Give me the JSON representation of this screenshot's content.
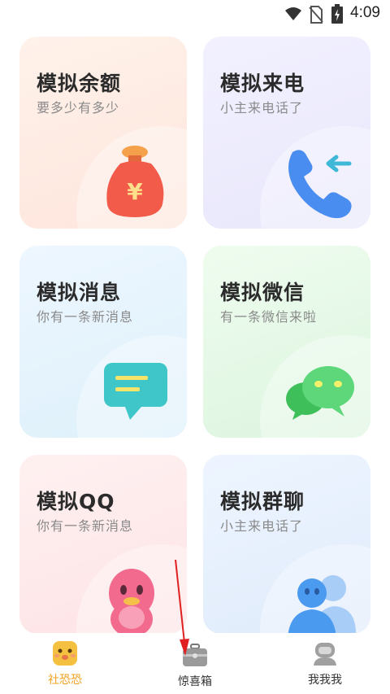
{
  "status_bar": {
    "time": "4:09",
    "icons": [
      "wifi-icon",
      "no-sim-icon",
      "battery-charging-icon"
    ]
  },
  "cards": [
    {
      "title": "模拟余额",
      "subtitle": "要多少有多少",
      "icon": "money-bag-icon"
    },
    {
      "title": "模拟来电",
      "subtitle": "小主来电话了",
      "icon": "incoming-call-icon"
    },
    {
      "title": "模拟消息",
      "subtitle": "你有一条新消息",
      "icon": "message-bubble-icon"
    },
    {
      "title": "模拟微信",
      "subtitle": "有一条微信来啦",
      "icon": "wechat-icon"
    },
    {
      "title": "模拟QQ",
      "subtitle": "你有一条新消息",
      "icon": "qq-penguin-icon"
    },
    {
      "title": "模拟群聊",
      "subtitle": "小主来电话了",
      "icon": "group-chat-icon"
    }
  ],
  "tabbar": {
    "tabs": [
      {
        "label": "社恐恐",
        "icon": "face-icon",
        "active": true,
        "color": "#f0a020"
      },
      {
        "label": "惊喜箱",
        "icon": "briefcase-icon",
        "active": false,
        "color": "#333333"
      },
      {
        "label": "我我我",
        "icon": "user-icon",
        "active": false,
        "color": "#333333"
      }
    ]
  },
  "annotation": {
    "type": "red-arrow",
    "color": "#e02020"
  }
}
